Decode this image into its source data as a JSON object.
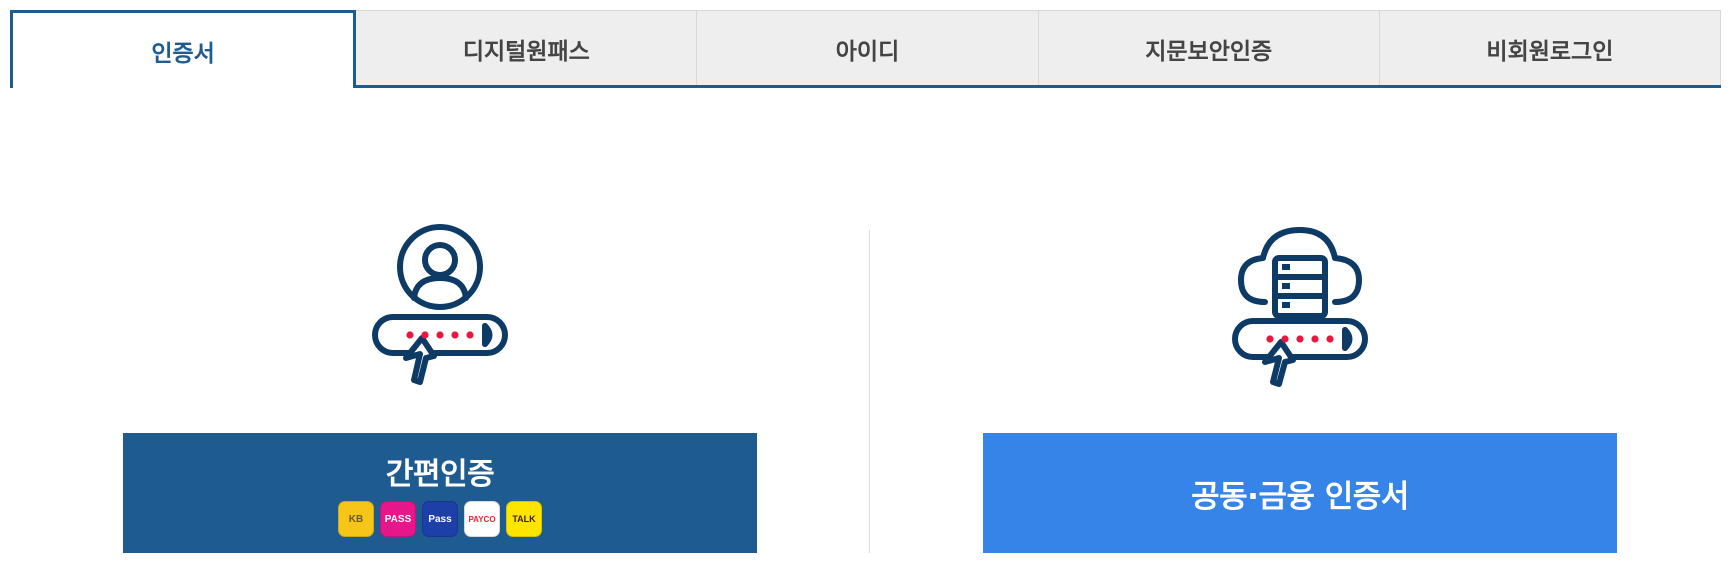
{
  "tabs": [
    {
      "label": "인증서",
      "active": true
    },
    {
      "label": "디지털원패스",
      "active": false
    },
    {
      "label": "아이디",
      "active": false
    },
    {
      "label": "지문보안인증",
      "active": false
    },
    {
      "label": "비회원로그인",
      "active": false
    }
  ],
  "simple_auth": {
    "label": "간편인증",
    "providers": [
      {
        "icon": "kb-icon",
        "text": "KB",
        "bg": "#f5c518",
        "fg": "#6b5a2e"
      },
      {
        "icon": "pass-icon",
        "text": "PASS",
        "bg": "#e6168b",
        "fg": "#ffffff"
      },
      {
        "icon": "samsung-pass-icon",
        "text": "Pass",
        "bg": "#1c3fa8",
        "fg": "#ffffff"
      },
      {
        "icon": "payco-icon",
        "text": "PAYCO",
        "bg": "#ffffff",
        "fg": "#e6262e"
      },
      {
        "icon": "kakaotalk-icon",
        "text": "TALK",
        "bg": "#fee500",
        "fg": "#3c1e1e"
      }
    ]
  },
  "certificate": {
    "label": "공동·금융 인증서"
  },
  "colors": {
    "primary": "#1d5b91",
    "accent": "#3684e8",
    "icon_stroke": "#0e3b66",
    "dots": "#e8173d"
  }
}
